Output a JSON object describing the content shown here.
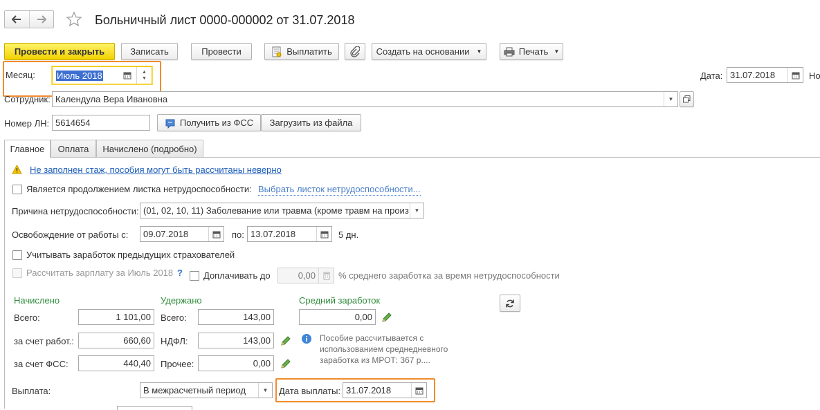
{
  "window": {
    "title": "Больничный лист 0000-000002 от 31.07.2018",
    "right_cut_label": "Но"
  },
  "toolbar": {
    "post_close": "Провести и закрыть",
    "save": "Записать",
    "post": "Провести",
    "pay": "Выплатить",
    "create_based": "Создать на основании",
    "print": "Печать"
  },
  "header": {
    "month_label": "Месяц:",
    "month_value": "Июль 2018",
    "date_label": "Дата:",
    "date_value": "31.07.2018",
    "employee_label": "Сотрудник:",
    "employee_value": "Календула Вера Ивановна",
    "ln_label": "Номер ЛН:",
    "ln_value": "5614654",
    "get_fss": "Получить из ФСС",
    "load_file": "Загрузить из файла"
  },
  "tabs": [
    {
      "label": "Главное"
    },
    {
      "label": "Оплата"
    },
    {
      "label": "Начислено (подробно)"
    }
  ],
  "main": {
    "warning": "Не заполнен стаж, пособия могут быть рассчитаны неверно",
    "continuation_label": "Является продолжением листка нетрудоспособности:",
    "continuation_link": "Выбрать листок нетрудоспособности...",
    "cause_label": "Причина нетрудоспособности:",
    "cause_value": "(01, 02, 10, 11) Заболевание или травма (кроме травм на произ",
    "release_label": "Освобождение от работы с:",
    "release_from": "09.07.2018",
    "release_to_label": "по:",
    "release_to": "13.07.2018",
    "days": "5 дн.",
    "prev_insurers": "Учитывать заработок предыдущих страхователей",
    "calc_salary": "Рассчитать зарплату за Июль 2018",
    "help": "?",
    "topup_label": "Доплачивать до",
    "topup_value": "0,00",
    "topup_suffix": "% среднего заработка за время нетрудоспособности"
  },
  "accrued": {
    "title": "Начислено",
    "total_label": "Всего:",
    "total": "1 101,00",
    "employer_label": "за счет работ.:",
    "employer": "660,60",
    "fss_label": "за счет ФСС:",
    "fss": "440,40"
  },
  "withheld": {
    "title": "Удержано",
    "total_label": "Всего:",
    "total": "143,00",
    "ndfl_label": "НДФЛ:",
    "ndfl": "143,00",
    "other_label": "Прочее:",
    "other": "0,00"
  },
  "average": {
    "title": "Средний заработок",
    "value": "0,00",
    "info": "Пособие рассчитывается с использованием среднедневного заработка из МРОТ: 367 р...."
  },
  "payment": {
    "label": "Выплата:",
    "value": "В межрасчетный период",
    "date_label": "Дата выплаты:",
    "date_value": "31.07.2018"
  },
  "colors": {
    "accent_orange": "#f08b2c",
    "primary_yellow": "#f2d200",
    "link_blue": "#1b5cb8",
    "green_title": "#2e8b3a"
  }
}
